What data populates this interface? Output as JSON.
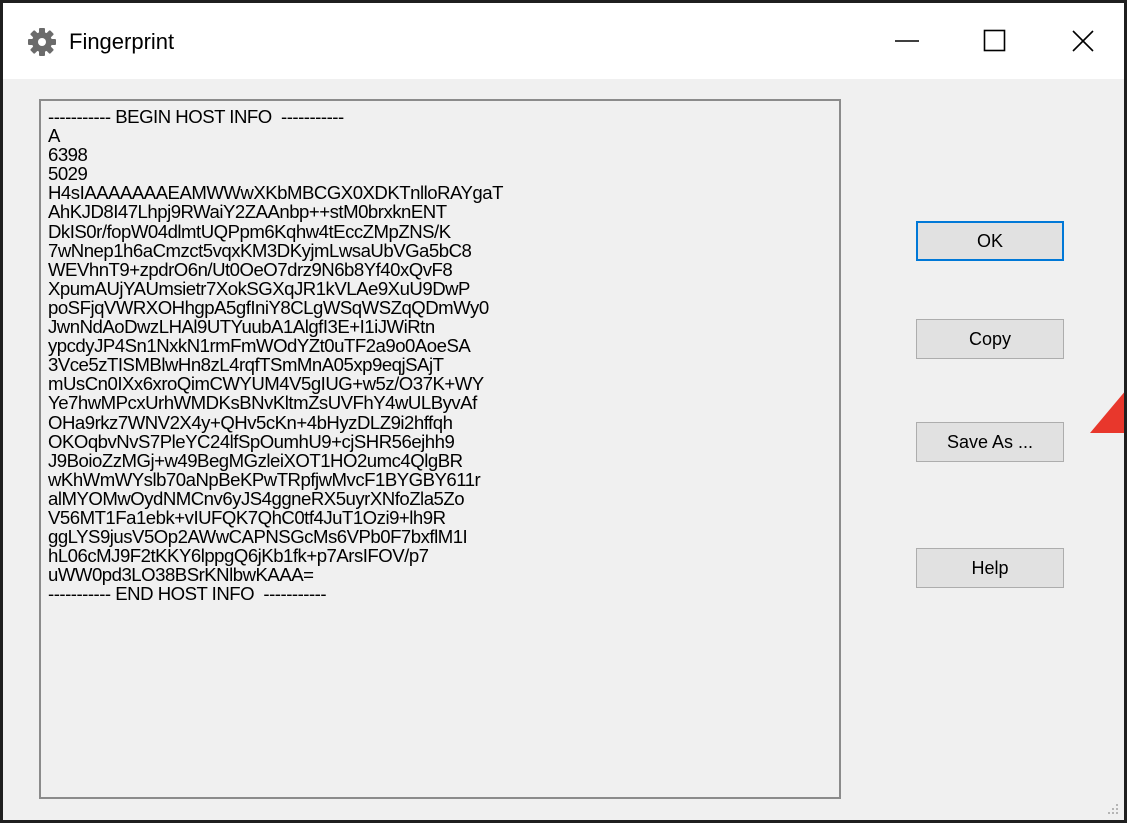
{
  "window": {
    "title": "Fingerprint",
    "icon": "gear-icon",
    "controls": [
      "minimize-icon",
      "maximize-icon",
      "close-icon"
    ]
  },
  "host_info": {
    "lines": [
      "----------- BEGIN HOST INFO  -----------",
      "A",
      "6398",
      "5029",
      "H4sIAAAAAAAEAMWWwXKbMBCGX0XDKTnlloRAYgaT",
      "AhKJD8I47Lhpj9RWaiY2ZAAnbp++stM0brxknENT",
      "DkIS0r/fopW04dlmtUQPpm6Kqhw4tEccZMpZNS/K",
      "7wNnep1h6aCmzct5vqxKM3DKyjmLwsaUbVGa5bC8",
      "WEVhnT9+zpdrO6n/Ut0OeO7drz9N6b8Yf40xQvF8",
      "XpumAUjYAUmsietr7XokSGXqJR1kVLAe9XuU9DwP",
      "poSFjqVWRXOHhgpA5gfIniY8CLgWSqWSZqQDmWy0",
      "JwnNdAoDwzLHAl9UTYuubA1AlgfI3E+I1iJWiRtn",
      "ypcdyJP4Sn1NxkN1rmFmWOdYZt0uTF2a9o0AoeSA",
      "3Vce5zTISMBlwHn8zL4rqfTSmMnA05xp9eqjSAjT",
      "mUsCn0IXx6xroQimCWYUM4V5gIUG+w5z/O37K+WY",
      "Ye7hwMPcxUrhWMDKsBNvKltmZsUVFhY4wULByvAf",
      "OHa9rkz7WNV2X4y+QHv5cKn+4bHyzDLZ9i2hffqh",
      "OKOqbvNvS7PleYC24lfSpOumhU9+cjSHR56ejhh9",
      "J9BoioZzMGj+w49BegMGzleiXOT1HO2umc4QlgBR",
      "wKhWmWYslb70aNpBeKPwTRpfjwMvcF1BYGBY611r",
      "alMYOMwOydNMCnv6yJS4ggneRX5uyrXNfoZla5Zo",
      "V56MT1Fa1ebk+vIUFQK7QhC0tf4JuT1Ozi9+lh9R",
      "ggLYS9jusV5Op2AWwCAPNSGcMs6VPb0F7bxflM1I",
      "hL06cMJ9F2tKKY6lppgQ6jKb1fk+p7ArsIFOV/p7",
      "uWW0pd3LO38BSrKNlbwKAAA=",
      "----------- END HOST INFO  -----------"
    ]
  },
  "buttons": {
    "ok": "OK",
    "copy": "Copy",
    "save_as": "Save As ...",
    "help": "Help"
  },
  "colors": {
    "annotation_arrow": "#e8372c",
    "default_button_border": "#0078d7"
  }
}
